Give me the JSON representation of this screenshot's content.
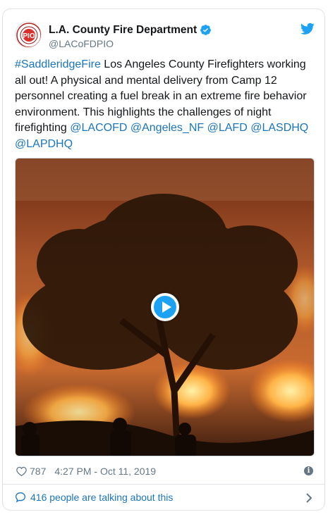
{
  "tweet": {
    "display_name": "L.A. County Fire Department",
    "handle": "@LACoFDPIO",
    "avatar_text": "PIO",
    "text_parts": [
      {
        "text": "#SaddleridgeFire",
        "link": true
      },
      {
        "text": " Los Angeles County Firefighters working all out! A physical and mental delivery from Camp 12 personnel creating a fuel break in an extreme fire behavior environment. This highlights the challenges of night firefighting ",
        "link": false
      },
      {
        "text": "@LACOFD",
        "link": true
      },
      {
        "text": " ",
        "link": false
      },
      {
        "text": "@Angeles_NF",
        "link": true
      },
      {
        "text": " ",
        "link": false
      },
      {
        "text": "@LAFD",
        "link": true
      },
      {
        "text": " ",
        "link": false
      },
      {
        "text": "@LASDHQ",
        "link": true
      },
      {
        "text": " ",
        "link": false
      },
      {
        "text": "@LAPDHQ",
        "link": true
      }
    ],
    "likes": "787",
    "timestamp": "4:27 PM - Oct 11, 2019"
  },
  "footer": {
    "talking_text": "416 people are talking about this"
  },
  "icons": {
    "twitter": "twitter-bird-icon",
    "verified": "verified-badge-icon",
    "play": "play-icon",
    "heart": "heart-icon",
    "info": "info-icon",
    "comment": "comment-bubble-icon",
    "chevron": "chevron-right-icon"
  },
  "colors": {
    "link": "#1b75bb",
    "twitter_blue": "#1da1f2",
    "muted": "#657786",
    "text": "#14171a"
  }
}
